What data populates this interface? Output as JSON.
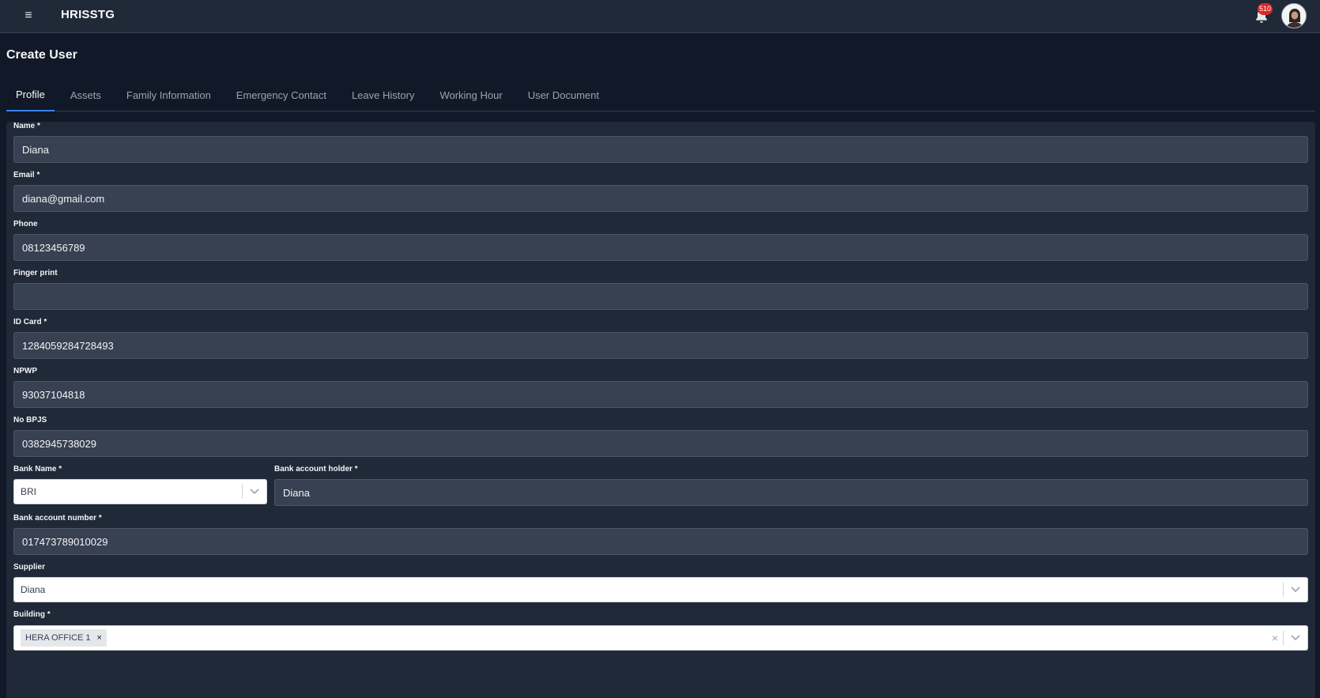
{
  "header": {
    "menu_icon": "≡",
    "app_name": "HRISSTG",
    "notification_count": "510"
  },
  "page": {
    "title": "Create User"
  },
  "tabs": [
    {
      "label": "Profile",
      "active": true
    },
    {
      "label": "Assets"
    },
    {
      "label": "Family Information"
    },
    {
      "label": "Emergency Contact"
    },
    {
      "label": "Leave History"
    },
    {
      "label": "Working Hour"
    },
    {
      "label": "User Document"
    }
  ],
  "form": {
    "name": {
      "label": "Name *",
      "value": "Diana"
    },
    "email": {
      "label": "Email *",
      "value": "diana@gmail.com"
    },
    "phone": {
      "label": "Phone",
      "value": "08123456789"
    },
    "finger_print": {
      "label": "Finger print",
      "value": ""
    },
    "id_card": {
      "label": "ID Card *",
      "value": "1284059284728493"
    },
    "npwp": {
      "label": "NPWP",
      "value": "93037104818"
    },
    "no_bpjs": {
      "label": "No BPJS",
      "value": "0382945738029"
    },
    "bank_name": {
      "label": "Bank Name *",
      "value": "BRI"
    },
    "bank_account_holder": {
      "label": "Bank account holder *",
      "value": "Diana"
    },
    "bank_account_number": {
      "label": "Bank account number *",
      "value": "017473789010029"
    },
    "supplier": {
      "label": "Supplier",
      "value": "Diana"
    },
    "building": {
      "label": "Building *",
      "chips": [
        "HERA OFFICE 1"
      ]
    }
  },
  "icons": {
    "notification": "bell-icon",
    "avatar": "user-avatar",
    "dropdown": "chevron-down-icon",
    "clear": "close-icon"
  },
  "colors": {
    "background": "#111827",
    "surface": "#1f2937",
    "input": "#374151",
    "accent": "#3b82f6",
    "badge": "#dc2626"
  }
}
